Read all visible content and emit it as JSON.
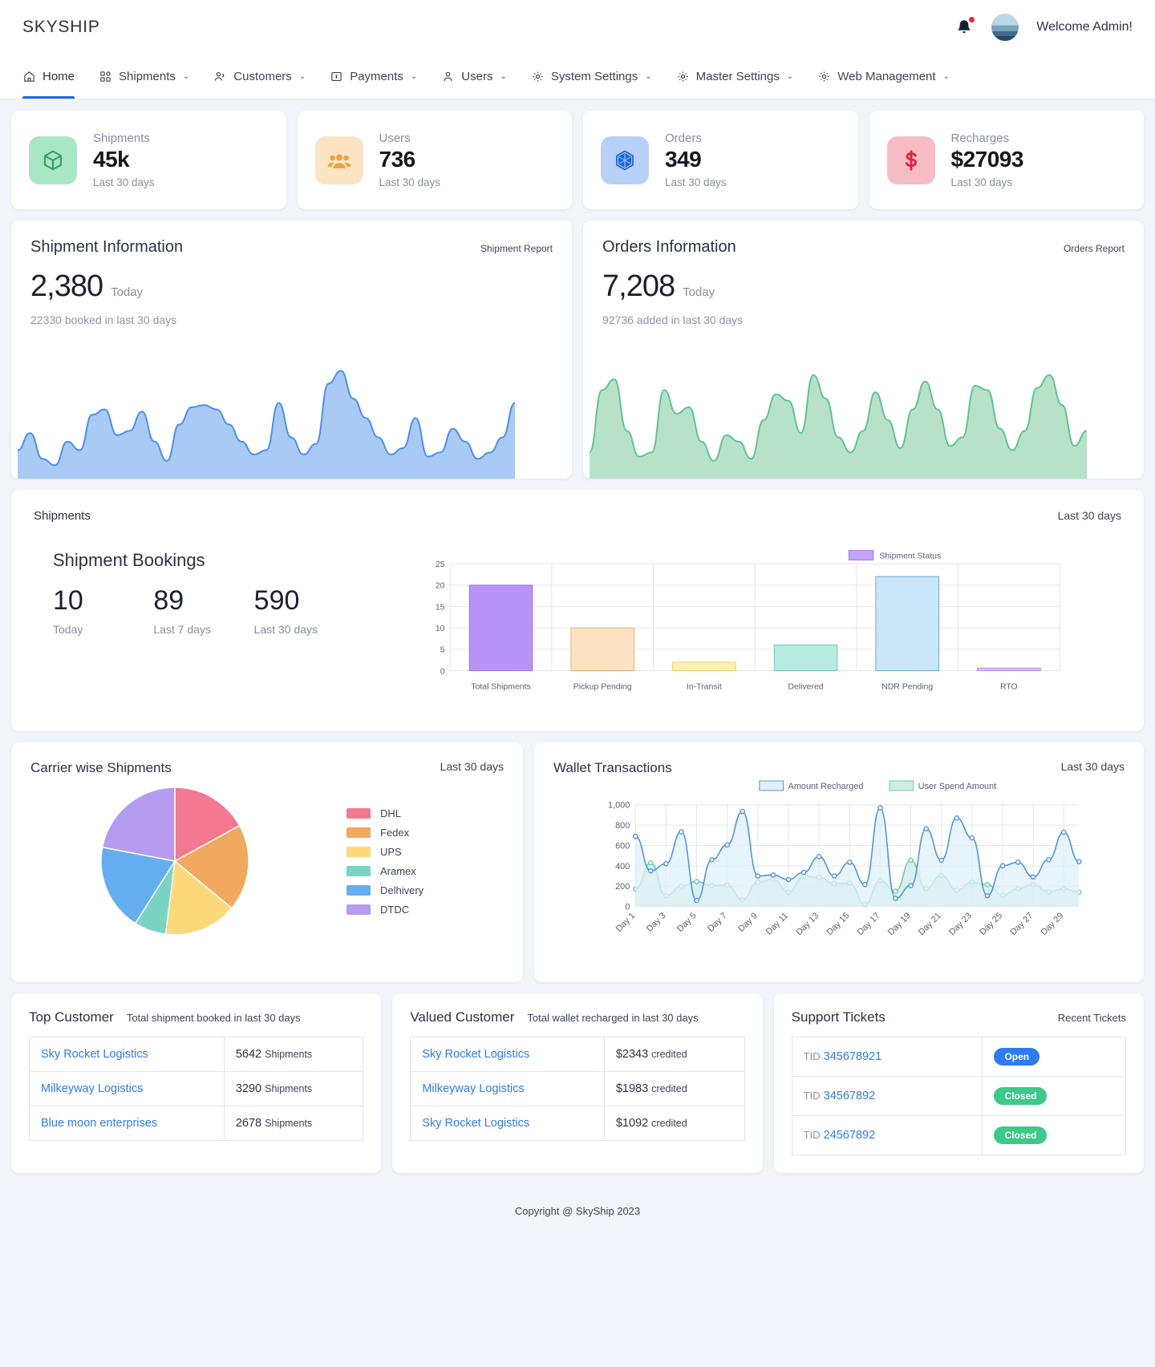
{
  "brand": "SKYSHIP",
  "header": {
    "welcome": "Welcome Admin!",
    "bell_icon": "bell-icon",
    "avatar_icon": "avatar"
  },
  "nav": [
    {
      "label": "Home",
      "icon": "home-icon",
      "caret": false,
      "active": true
    },
    {
      "label": "Shipments",
      "icon": "grid-icon",
      "caret": true,
      "active": false
    },
    {
      "label": "Customers",
      "icon": "users-icon",
      "caret": true,
      "active": false
    },
    {
      "label": "Payments",
      "icon": "money-icon",
      "caret": true,
      "active": false
    },
    {
      "label": "Users",
      "icon": "user-icon",
      "caret": true,
      "active": false
    },
    {
      "label": "System Settings",
      "icon": "gear-icon",
      "caret": true,
      "active": false
    },
    {
      "label": "Master Settings",
      "icon": "gear-icon",
      "caret": true,
      "active": false
    },
    {
      "label": "Web Management",
      "icon": "gear-icon",
      "caret": true,
      "active": false
    }
  ],
  "caret_glyph": "⌄",
  "stats": [
    {
      "label": "Shipments",
      "value": "45k",
      "sub": "Last 30 days",
      "icon": "box-icon",
      "bg": "#a9e6c6",
      "fg": "#2f9f62"
    },
    {
      "label": "Users",
      "value": "736",
      "sub": "Last 30 days",
      "icon": "people-icon",
      "bg": "#fce5c4",
      "fg": "#eda33f"
    },
    {
      "label": "Orders",
      "value": "349",
      "sub": "Last 30 days",
      "icon": "hexagon-icon",
      "bg": "#b7d0f6",
      "fg": "#1c66d8"
    },
    {
      "label": "Recharges",
      "value": "$27093",
      "sub": "Last 30 days",
      "icon": "dollar-icon",
      "bg": "#f6bcc6",
      "fg": "#e0233f"
    }
  ],
  "info_panels": [
    {
      "title": "Shipment Information",
      "report": "Shipment Report",
      "value": "2,380",
      "tag": "Today",
      "sub": "22330 booked in last 30 days",
      "stroke": "#4c8ff0",
      "fill": "#a8caf5"
    },
    {
      "title": "Orders Information",
      "report": "Orders Report",
      "value": "7,208",
      "tag": "Today",
      "sub": "92736 added in last 30 days",
      "stroke": "#5dc68f",
      "fill": "#b7e2c9"
    }
  ],
  "shipments_section": {
    "kicker": "Shipments",
    "last30": "Last 30 days",
    "bookings_title": "Shipment Bookings",
    "bookings": [
      {
        "value": "10",
        "label": "Today"
      },
      {
        "value": "89",
        "label": "Last 7 days"
      },
      {
        "value": "590",
        "label": "Last 30 days"
      }
    ]
  },
  "carrier_card": {
    "title": "Carrier wise Shipments",
    "last30": "Last 30 days"
  },
  "wallet_card": {
    "title": "Wallet Transactions",
    "last30": "Last 30 days"
  },
  "tables": [
    {
      "title": "Top Customer",
      "subtitle": "Total shipment booked in last 30 days",
      "rows": [
        {
          "name": "Sky Rocket Logistics",
          "value": "5642",
          "unit": "Shipments"
        },
        {
          "name": "Milkeyway Logistics",
          "value": "3290",
          "unit": "Shipments"
        },
        {
          "name": "Blue moon enterprises",
          "value": "2678",
          "unit": "Shipments"
        }
      ]
    },
    {
      "title": "Valued Customer",
      "subtitle": "Total wallet recharged in last 30 days",
      "rows": [
        {
          "name": "Sky Rocket Logistics",
          "value": "$2343",
          "unit": "credited"
        },
        {
          "name": "Milkeyway Logistics",
          "value": "$1983",
          "unit": "credited"
        },
        {
          "name": "Sky Rocket Logistics",
          "value": "$1092",
          "unit": "credited"
        }
      ]
    }
  ],
  "tickets": {
    "title": "Support Tickets",
    "subtitle": "Recent Tickets",
    "prefix": "TID",
    "rows": [
      {
        "id": "345678921",
        "status": "Open",
        "status_color": "#2f7bf6"
      },
      {
        "id": "34567892",
        "status": "Closed",
        "status_color": "#3cc98a"
      },
      {
        "id": "24567892",
        "status": "Closed",
        "status_color": "#3cc98a"
      }
    ]
  },
  "footer": "Copyright @ SkyShip 2023",
  "chart_data": [
    {
      "type": "area",
      "name": "shipment-information-sparkline",
      "title": "Shipment Information",
      "values": [
        22,
        38,
        14,
        8,
        30,
        22,
        55,
        60,
        36,
        40,
        58,
        30,
        12,
        46,
        62,
        64,
        60,
        46,
        30,
        18,
        22,
        66,
        34,
        18,
        28,
        84,
        96,
        70,
        52,
        34,
        18,
        24,
        52,
        16,
        20,
        42,
        30,
        14,
        20,
        34,
        66
      ],
      "ylim": [
        0,
        100
      ],
      "grid": false,
      "legend": "none",
      "stroke": "#4c8ff0",
      "fill": "#a8caf5"
    },
    {
      "type": "area",
      "name": "orders-information-sparkline",
      "title": "Orders Information",
      "values": [
        20,
        78,
        88,
        40,
        16,
        20,
        78,
        56,
        62,
        30,
        12,
        36,
        30,
        14,
        50,
        74,
        68,
        38,
        92,
        70,
        34,
        20,
        40,
        76,
        50,
        24,
        60,
        86,
        60,
        26,
        34,
        82,
        78,
        42,
        22,
        40,
        80,
        92,
        64,
        26,
        40
      ],
      "ylim": [
        0,
        100
      ],
      "grid": false,
      "legend": "none",
      "stroke": "#5dc68f",
      "fill": "#b7e2c9"
    },
    {
      "type": "bar",
      "name": "shipment-status-bar-chart",
      "title": "",
      "legend": [
        "Shipment Status"
      ],
      "legend_position": "top",
      "categories": [
        "Total Shipments",
        "Pickup Pending",
        "In-Transit",
        "Delivered",
        "NDR Pending",
        "RTO"
      ],
      "values": [
        20,
        10,
        2,
        6,
        22,
        0.6
      ],
      "colors": [
        "#b794f6",
        "#fde3c4",
        "#fdf0b8",
        "#b8ece0",
        "#cbe6f9",
        "#d9c6f7"
      ],
      "borders": [
        "#9b6ef0",
        "#f0ad57",
        "#f2d24f",
        "#5ec9b1",
        "#62a8e0",
        "#ad86ee"
      ],
      "yticks": [
        0,
        5,
        10,
        15,
        20,
        25
      ],
      "ylim": [
        0,
        25
      ],
      "xlabel": "",
      "ylabel": "",
      "grid": true
    },
    {
      "type": "pie",
      "name": "carrier-wise-shipments-pie",
      "title": "Carrier wise Shipments",
      "labels": [
        "DHL",
        "Fedex",
        "UPS",
        "Aramex",
        "Delhivery",
        "DTDC"
      ],
      "values": [
        17,
        19,
        16,
        7,
        19,
        22
      ],
      "colors": [
        "#f2798f",
        "#f0a95e",
        "#fcd97a",
        "#79d4c4",
        "#64aef0",
        "#b59cf0"
      ],
      "legend_position": "right"
    },
    {
      "type": "line",
      "name": "wallet-transactions-line-chart",
      "title": "Wallet Transactions",
      "legend_position": "top",
      "x": [
        "Day 1",
        "Day 2",
        "Day 3",
        "Day 4",
        "Day 5",
        "Day 6",
        "Day 7",
        "Day 8",
        "Day 9",
        "Day 10",
        "Day 11",
        "Day 12",
        "Day 13",
        "Day 14",
        "Day 15",
        "Day 16",
        "Day 17",
        "Day 18",
        "Day 19",
        "Day 20",
        "Day 21",
        "Day 22",
        "Day 23",
        "Day 24",
        "Day 25",
        "Day 26",
        "Day 27",
        "Day 28",
        "Day 29",
        "Day 30"
      ],
      "xticks": [
        "Day 1",
        "Day 3",
        "Day 5",
        "Day 7",
        "Day 9",
        "Day 11",
        "Day 13",
        "Day 15",
        "Day 17",
        "Day 19",
        "Day 21",
        "Day 23",
        "Day 25",
        "Day 27",
        "Day 29"
      ],
      "yticks": [
        0,
        200,
        400,
        600,
        800,
        1000
      ],
      "ytick_labels": [
        "0",
        "200",
        "400",
        "600",
        "800",
        "1,000"
      ],
      "ylim": [
        0,
        1000
      ],
      "series": [
        {
          "name": "Amount Recharged",
          "color": "#4f94e8",
          "fill": "#dff0f7",
          "values": [
            690,
            350,
            420,
            735,
            60,
            460,
            605,
            935,
            300,
            310,
            265,
            335,
            490,
            300,
            435,
            215,
            970,
            80,
            205,
            765,
            455,
            870,
            675,
            105,
            400,
            435,
            290,
            460,
            730,
            440
          ]
        },
        {
          "name": "User Spend Amount",
          "color": "#6cc9b4",
          "fill": "#cdeee4",
          "values": [
            170,
            430,
            105,
            200,
            245,
            205,
            210,
            65,
            240,
            265,
            140,
            295,
            285,
            225,
            230,
            20,
            255,
            150,
            455,
            175,
            305,
            160,
            240,
            215,
            110,
            175,
            215,
            145,
            175,
            140
          ]
        }
      ],
      "grid": true
    }
  ]
}
